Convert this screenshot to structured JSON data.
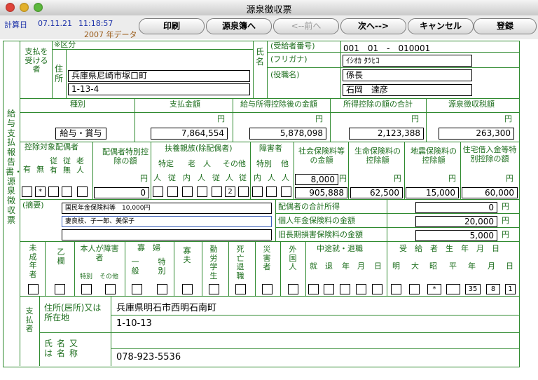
{
  "window": {
    "title": "源泉徴収票"
  },
  "info": {
    "calc_label": "計算日",
    "calc_date": "07.11.21",
    "calc_time": "11:18:57",
    "year_text": "2007 年データ"
  },
  "toolbar": {
    "print": "印刷",
    "ledger": "源泉簿へ",
    "prev": "<--前へ",
    "next": "次へ-->",
    "cancel": "キャンセル",
    "register": "登録"
  },
  "form": {
    "vertical_title": "給与支払報告書・源泉徴収票",
    "payee_label": "支払を受ける者",
    "kubun": "※区分",
    "address_label": "住所",
    "address1": "兵庫県尼崎市塚口町",
    "address2": "1-13-4",
    "name_label": "氏名",
    "recipient_no_label": "(受給者番号)",
    "recipient_no": "001　01　-　010001",
    "furigana_label": "(フリガナ)",
    "furigana": "ｲｼｵｶ ﾀﾂﾋｺ",
    "position_label": "(役職名)",
    "position": "係長",
    "name": "石岡　達彦",
    "headers": {
      "type": "種別",
      "pay": "支払金額",
      "after": "給与所得控除後の金額",
      "ded": "所得控除の額の合計",
      "tax": "源泉徴収税額"
    },
    "yen": "円",
    "type_value": "給与・賞与",
    "pay_amount": "7,864,554",
    "after_amount": "5,878,098",
    "ded_amount": "2,123,388",
    "tax_amount": "263,300",
    "spouse_header": "控除対象配偶者",
    "spouse_cols": [
      "有",
      "無",
      "従有",
      "従無",
      "老人"
    ],
    "spouse_mark": "*",
    "spouse_special": "配偶者特別控除の額",
    "spouse_special_value": "0",
    "dependents_header": "扶養親族(除配偶者)",
    "dependents_sub": [
      "特定",
      "老　人",
      "その他"
    ],
    "dep_cols": [
      "人",
      "従",
      "内",
      "人",
      "従",
      "人",
      "従"
    ],
    "dep_other_value": "2",
    "disabled_header": "障害者",
    "disabled_sub": [
      "特別",
      "他"
    ],
    "disabled_cols": [
      "内",
      "人",
      "人"
    ],
    "social_header": "社会保険料等の金額",
    "social1": "8,000",
    "social2": "905,888",
    "life_header": "生命保険料の控除額",
    "life_value": "62,500",
    "quake_header": "地震保険料の控除額",
    "quake_value": "15,000",
    "housing_header": "住宅借入金等特別控除の額",
    "housing_value": "60,000",
    "remarks_label": "(摘要)",
    "remarks1": "国民年金保険料等　10,000円",
    "remarks2": "妻良枝、子一郎、美保子",
    "remarks3": "",
    "spouse_income_label": "配偶者の合計所得",
    "spouse_income": "0",
    "pension_label": "個人年金保険料の金額",
    "pension": "20,000",
    "longterm_label": "旧長期損害保険料の金額",
    "longterm": "5,000",
    "bottom_headers": {
      "minor": "未成年者",
      "otsu": "乙欄",
      "self_disabled": "本人が障害者",
      "sd_special": "特別",
      "sd_other": "その他",
      "widow": "寡　婦",
      "widow_general": "一般",
      "widow_special": "特別",
      "widower": "寡夫",
      "student": "勤労学生",
      "death": "死亡退職",
      "disaster": "災害者",
      "foreign": "外国人",
      "midway": "中途就・退職",
      "midway_cols": [
        "就",
        "退",
        "年",
        "月",
        "日"
      ],
      "birth": "受　給　者　生　年　月　日",
      "birth_cols": [
        "明",
        "大",
        "昭",
        "平",
        "年",
        "月",
        "日"
      ]
    },
    "showa_mark": "*",
    "birth_year": "35",
    "birth_month": "8",
    "birth_day": "1",
    "payer_label": "支払者",
    "payer_address_label": "住所(居所)又は所在地",
    "payer_address1": "兵庫県明石市西明石南町",
    "payer_address2": "1-10-13",
    "payer_name_label": "氏名又は名称",
    "payer_phone": "078-923-5536"
  }
}
